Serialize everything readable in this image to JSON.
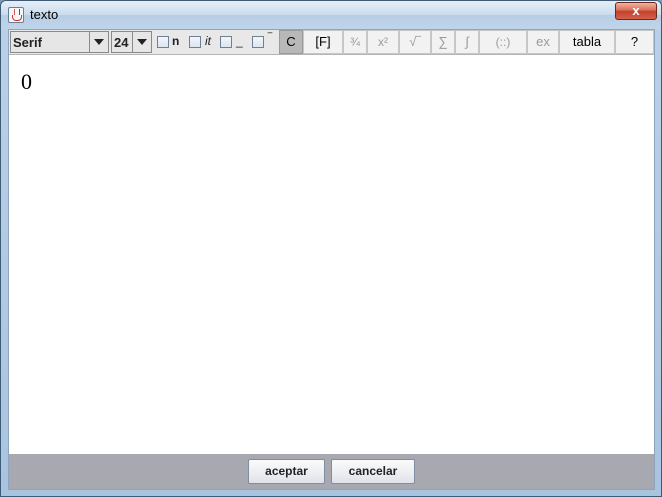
{
  "window": {
    "title": "texto",
    "close_glyph": "x"
  },
  "toolbar": {
    "font_family": "Serif",
    "font_size": "24",
    "bold_label": "n",
    "italic_label": "it",
    "underline_label": "_",
    "overline_label": "‾",
    "color_button": "C",
    "formula_button": "[F]",
    "fraction_button": "¾",
    "power_button": "x²",
    "sqrt_button": "√‾",
    "sum_button": "∑",
    "integral_button": "∫",
    "matrix_button": "(::)",
    "ex_button": "ex",
    "table_button": "tabla",
    "help_button": "?"
  },
  "editor": {
    "content": "0"
  },
  "buttons": {
    "accept": "aceptar",
    "cancel": "cancelar"
  }
}
